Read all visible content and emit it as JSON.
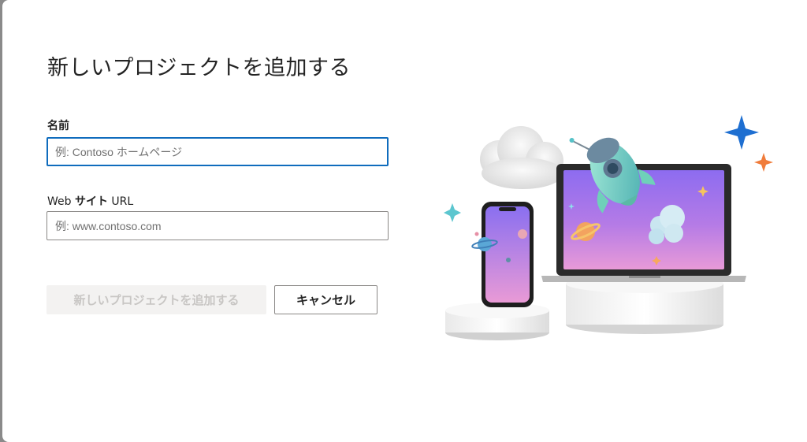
{
  "dialog": {
    "title": "新しいプロジェクトを追加する"
  },
  "form": {
    "name_label": "名前",
    "name_placeholder": "例: Contoso ホームページ",
    "name_value": "",
    "web_label_prefix": "Web ",
    "web_label_bold": "サイト",
    "web_label_suffix": " URL",
    "web_placeholder": "例: www.contoso.com",
    "web_value": ""
  },
  "buttons": {
    "add_label": "新しいプロジェクトを追加する",
    "cancel_label": "キャンセル"
  },
  "colors": {
    "focus_border": "#0f6cbd",
    "disabled_bg": "#f3f2f1",
    "disabled_text": "#c8c6c4",
    "sparkle_blue": "#1e6fd1",
    "sparkle_orange": "#f07c3b",
    "sparkle_teal": "#5cc6cf"
  },
  "illustration": {
    "icons": [
      "rocket-icon",
      "cloud-icon",
      "laptop-icon",
      "phone-icon",
      "planet-icon",
      "sparkle-icon"
    ]
  }
}
